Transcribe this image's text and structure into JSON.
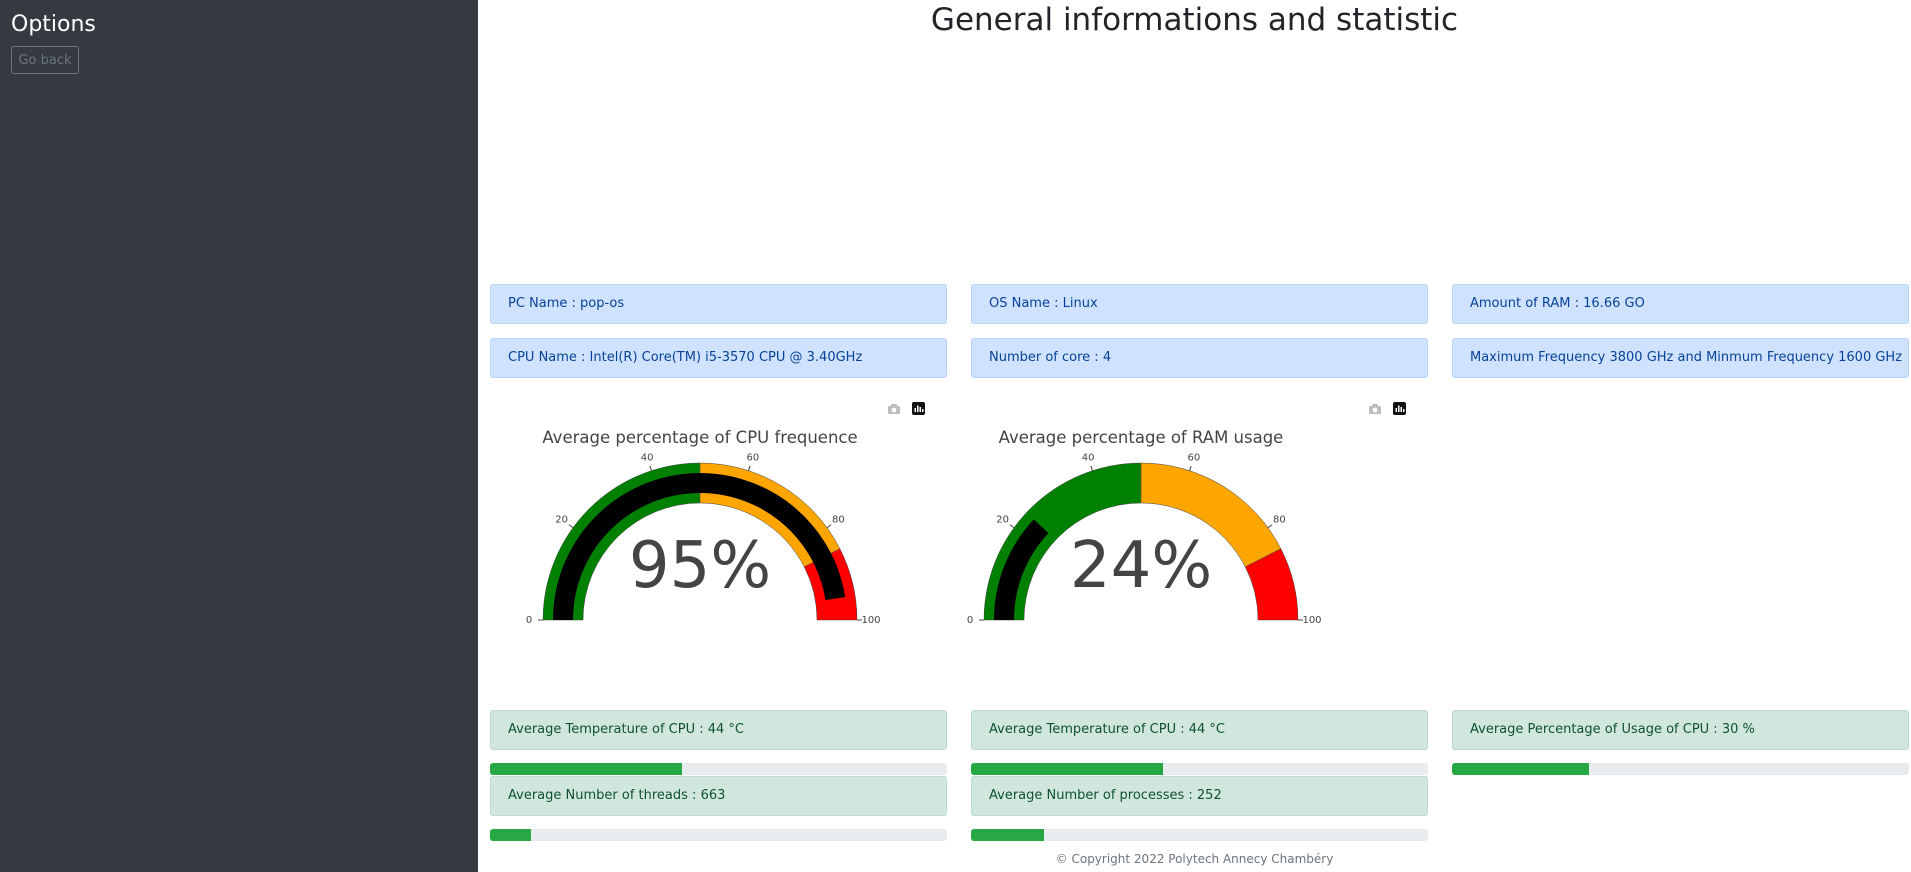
{
  "sidebar": {
    "title": "Options",
    "back_label": "Go back"
  },
  "page": {
    "title": "General informations and statistic"
  },
  "info_cards": [
    {
      "text": "PC Name : pop-os"
    },
    {
      "text": "OS Name : Linux"
    },
    {
      "text": "Amount of RAM : 16.66 GO"
    },
    {
      "text": "CPU Name : Intel(R) Core(TM) i5-3570 CPU @ 3.40GHz"
    },
    {
      "text": "Number of core : 4"
    },
    {
      "text": "Maximum Frequency 3800 GHz and Minmum Frequency 1600 GHz"
    }
  ],
  "gauges": [
    {
      "title": "Average percentage of CPU frequence",
      "value": 95,
      "display": "95%"
    },
    {
      "title": "Average percentage of RAM usage",
      "value": 24,
      "display": "24%"
    }
  ],
  "gauge_common": {
    "range": [
      0,
      100
    ],
    "ticks": [
      "0",
      "20",
      "40",
      "60",
      "80",
      "100"
    ],
    "tick_values": [
      0,
      20,
      40,
      60,
      80,
      100
    ],
    "steps": [
      {
        "from": 0,
        "to": 50,
        "color": "#008000"
      },
      {
        "from": 50,
        "to": 85,
        "color": "#ffa500"
      },
      {
        "from": 85,
        "to": 100,
        "color": "#ff0000"
      }
    ],
    "bar_color": "#000000"
  },
  "modebar": {
    "camera_icon": "camera-icon",
    "plotly_icon": "plotly-logo-icon"
  },
  "stats": [
    {
      "text": "Average Temperature of CPU : 44 °C",
      "fraction": 0.42
    },
    {
      "text": "Average Temperature of CPU : 44 °C",
      "fraction": 0.42
    },
    {
      "text": "Average Percentage of Usage of CPU : 30 %",
      "fraction": 0.3
    },
    {
      "text": "Average Number of threads : 663",
      "fraction": 0.09
    },
    {
      "text": "Average Number of processes : 252",
      "fraction": 0.16
    }
  ],
  "footer": {
    "text": "© Copyright 2022 Polytech Annecy Chambéry"
  }
}
